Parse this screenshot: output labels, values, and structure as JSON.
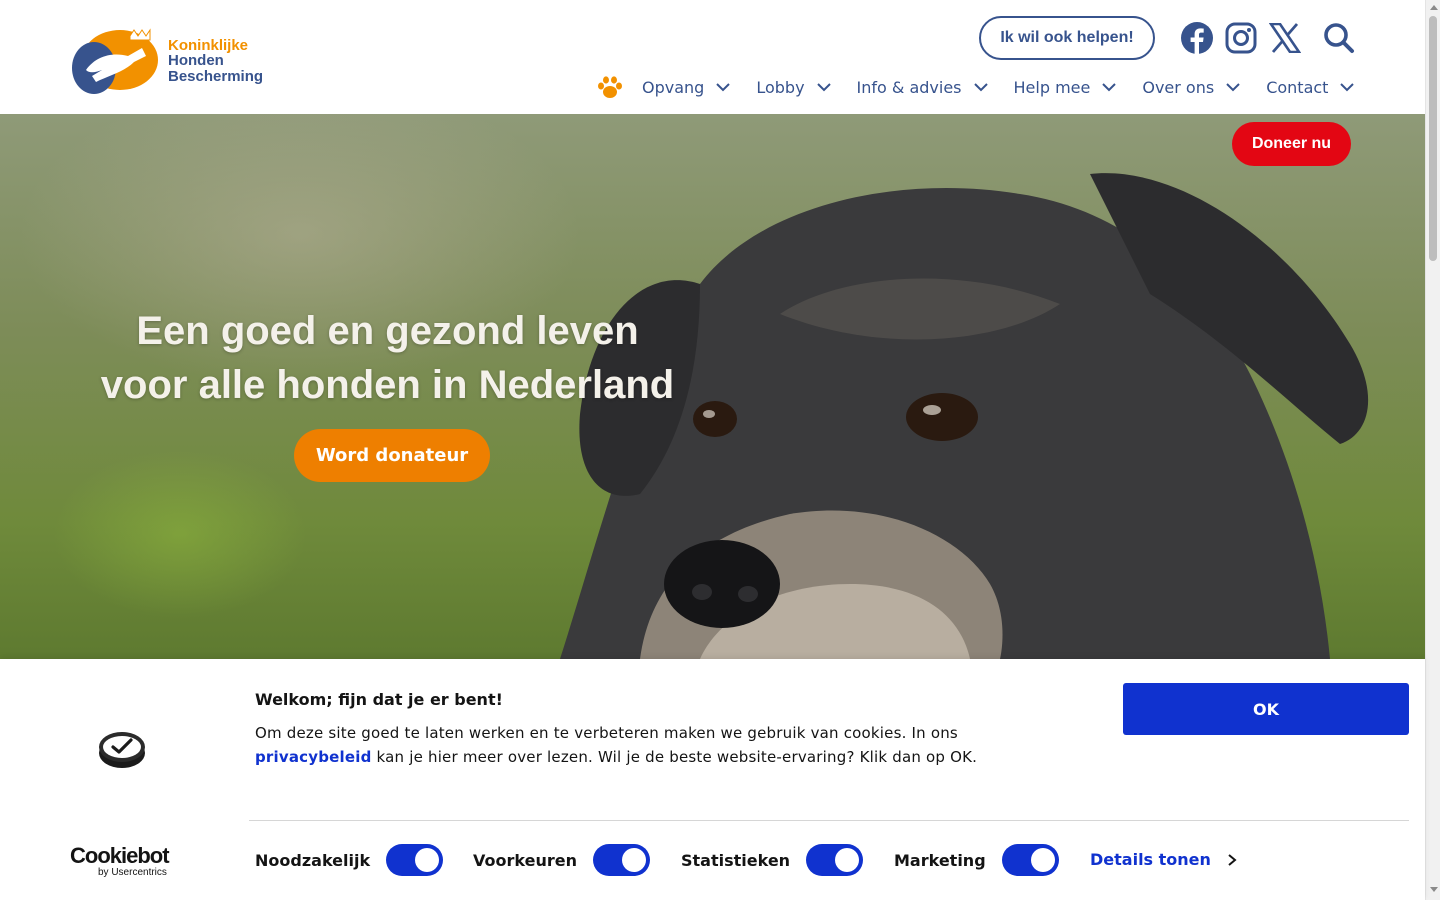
{
  "brand": {
    "line1": "Koninklijke",
    "line2": "Honden",
    "line3": "Bescherming",
    "colors": {
      "orange": "#f29100",
      "navy": "#37538d",
      "red": "#e30613",
      "cookie_blue": "#1032cf"
    }
  },
  "header": {
    "help_button": "Ik wil ook helpen!",
    "social": [
      "facebook-icon",
      "instagram-icon",
      "x-icon"
    ],
    "search_icon": "search-icon"
  },
  "nav": {
    "home_icon": "paw-icon",
    "items": [
      {
        "label": "Opvang"
      },
      {
        "label": "Lobby"
      },
      {
        "label": "Info & advies"
      },
      {
        "label": "Help mee"
      },
      {
        "label": "Over ons"
      },
      {
        "label": "Contact"
      }
    ]
  },
  "hero": {
    "title_line1": "Een goed en gezond leven",
    "title_line2": "voor alle honden in Nederland",
    "cta": "Word donateur",
    "donate": "Doneer nu"
  },
  "cookie": {
    "title": "Welkom; fijn dat je er bent!",
    "text_part1": "Om deze site goed te laten werken en te verbeteren maken we gebruik van cookies. In ons ",
    "link": "privacybeleid",
    "text_part2": " kan je hier meer over lezen. Wil je de beste website-ervaring? Klik dan op OK.",
    "ok": "OK",
    "provider_main": "Cookiebot",
    "provider_sub": "by Usercentrics",
    "toggles": [
      {
        "label": "Noodzakelijk",
        "on": true
      },
      {
        "label": "Voorkeuren",
        "on": true
      },
      {
        "label": "Statistieken",
        "on": true
      },
      {
        "label": "Marketing",
        "on": true
      }
    ],
    "details": "Details tonen"
  }
}
